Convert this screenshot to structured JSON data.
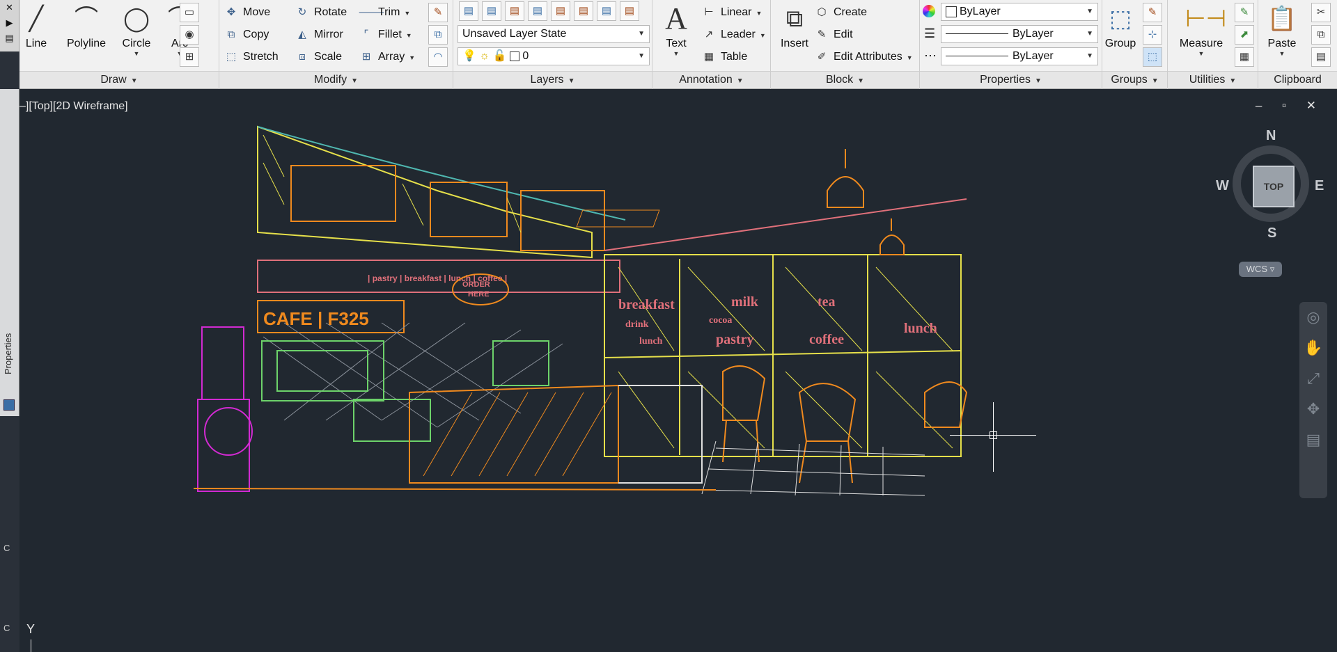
{
  "left_strip": {
    "top_icons": [
      "✕",
      "▶",
      "▤"
    ],
    "properties_label": "Properties",
    "markers": [
      "C",
      "C"
    ]
  },
  "draw": {
    "title": "Draw",
    "line": "Line",
    "polyline": "Polyline",
    "circle": "Circle",
    "arc": "Arc"
  },
  "modify": {
    "title": "Modify",
    "move": "Move",
    "rotate": "Rotate",
    "trim": "Trim",
    "copy": "Copy",
    "mirror": "Mirror",
    "fillet": "Fillet",
    "stretch": "Stretch",
    "scale": "Scale",
    "array": "Array"
  },
  "layers": {
    "title": "Layers",
    "layer_state": "Unsaved Layer State",
    "current_layer": "0"
  },
  "annotation": {
    "title": "Annotation",
    "text": "Text",
    "linear": "Linear",
    "leader": "Leader",
    "table": "Table"
  },
  "block": {
    "title": "Block",
    "insert": "Insert",
    "create": "Create",
    "edit": "Edit",
    "edit_attributes": "Edit Attributes"
  },
  "properties": {
    "title": "Properties",
    "color": "ByLayer",
    "lineweight": "ByLayer",
    "linetype": "ByLayer"
  },
  "groups": {
    "title": "Groups",
    "group": "Group"
  },
  "utilities": {
    "title": "Utilities",
    "measure": "Measure"
  },
  "clipboard": {
    "title": "Clipboard",
    "paste": "Paste"
  },
  "viewport": {
    "title": "–][Top][2D Wireframe]",
    "window_controls": "– ▫ ✕",
    "viewcube": {
      "top": "TOP",
      "n": "N",
      "s": "S",
      "e": "E",
      "w": "W"
    },
    "wcs": "WCS ▿",
    "ucs_label": "Y"
  },
  "sketch_text": {
    "cafe_sign": "CAFE | F325",
    "menu_strip": "| pastry | breakfast | lunch | coffee |",
    "order_bubble_1": "ORDER",
    "order_bubble_2": "HERE",
    "window_words": [
      "breakfast",
      "drink",
      "lunch",
      "milk",
      "cocoa",
      "pastry",
      "tea",
      "coffee",
      "lunch"
    ]
  },
  "colors": {
    "ribbon_bg": "#f1f1f1",
    "canvas_bg": "#212830",
    "yellow": "#e6e04a",
    "orange": "#f08a1e",
    "magenta": "#d22ad2",
    "green": "#6dd36a",
    "pink": "#e0707a",
    "cyan": "#4fb7b0"
  }
}
